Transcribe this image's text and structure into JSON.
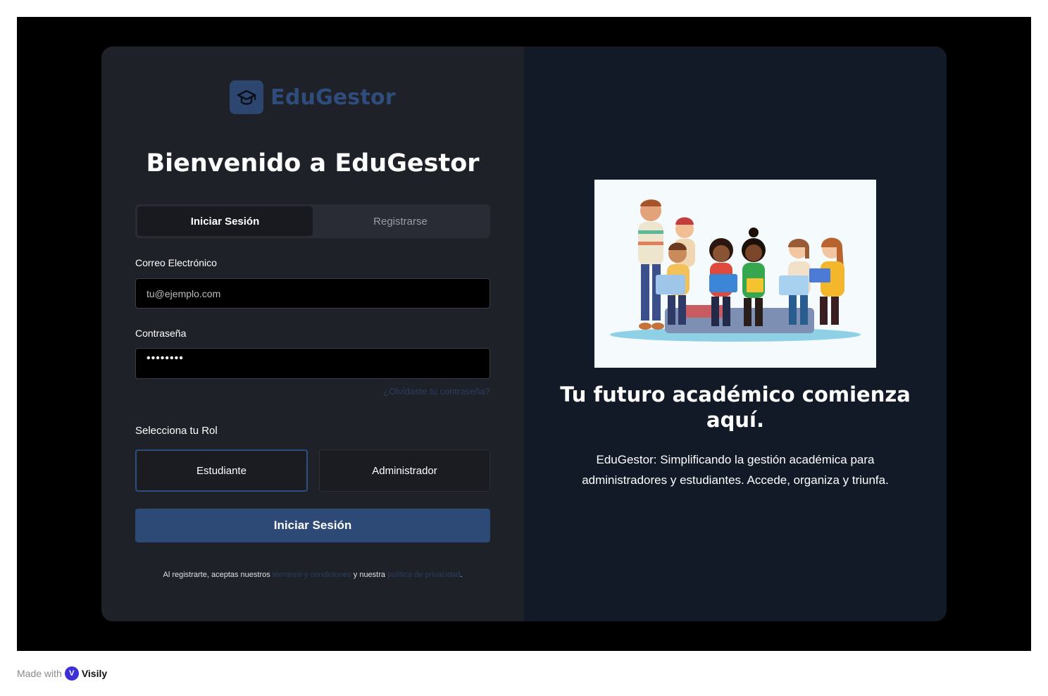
{
  "brand": {
    "name": "EduGestor",
    "icon": "graduation-cap-icon",
    "color": "#2f4d7c"
  },
  "login": {
    "title": "Bienvenido a EduGestor",
    "tabs": [
      {
        "label": "Iniciar Sesión",
        "active": true
      },
      {
        "label": "Registrarse",
        "active": false
      }
    ],
    "email": {
      "label": "Correo Electrónico",
      "value": "",
      "placeholder": "tu@ejemplo.com"
    },
    "password": {
      "label": "Contraseña",
      "masked_value": "••••••••"
    },
    "forgot_link": "¿Olvidaste tu contraseña?",
    "role": {
      "label": "Selecciona tu Rol",
      "options": [
        {
          "label": "Estudiante",
          "selected": true
        },
        {
          "label": "Administrador",
          "selected": false
        }
      ]
    },
    "submit_label": "Iniciar Sesión",
    "terms": {
      "prefix": "Al registrarte, aceptas nuestros",
      "terms_link": "términos y condiciones",
      "middle": "y nuestra",
      "privacy_link": "política de privacidad",
      "suffix": "."
    }
  },
  "hero": {
    "tagline": "Tu futuro académico comienza aquí.",
    "description": "EduGestor: Simplificando la gestión académica para administradores y estudiantes. Accede, organiza y triunfa."
  },
  "footer": {
    "made_with": "Made with",
    "brand": "Visily"
  },
  "colors": {
    "accent": "#2d4a76",
    "left_panel": "#1f2129",
    "right_panel": "#121a28",
    "link": "#2b3d5d"
  }
}
